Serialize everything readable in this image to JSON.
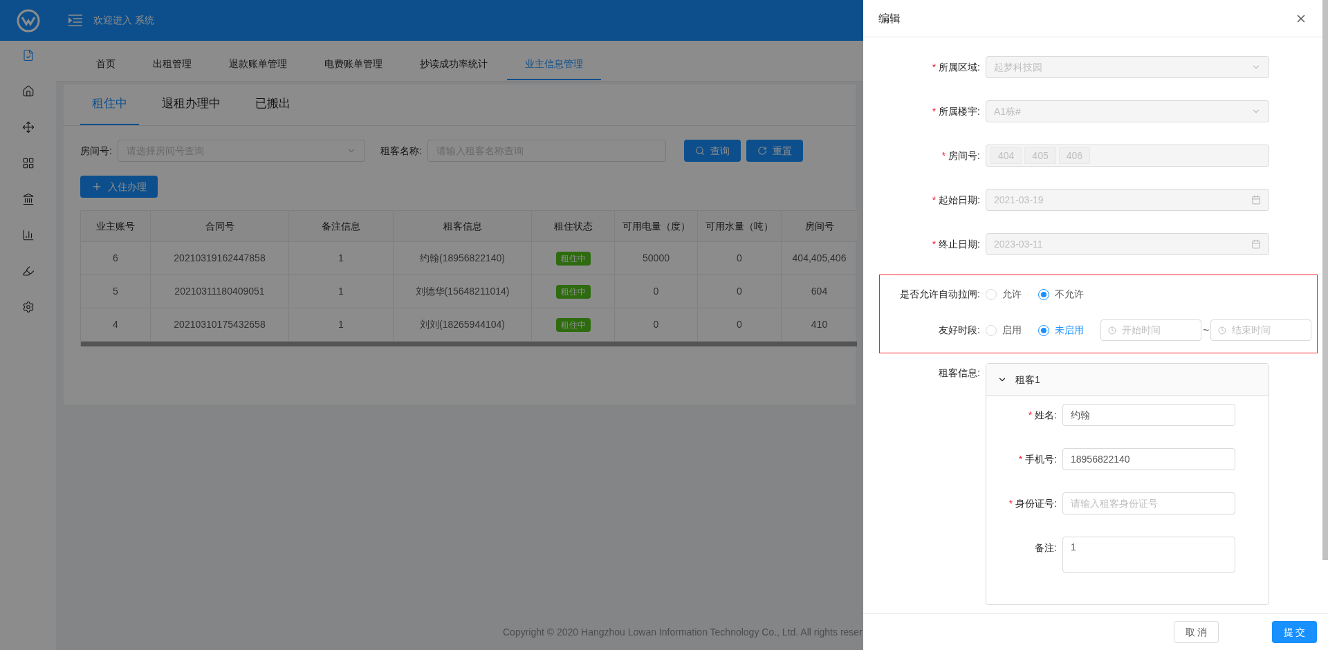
{
  "header": {
    "title": "欢迎进入 系统"
  },
  "sidebar": {
    "items": [
      {
        "kind": "doc",
        "selected": true
      },
      {
        "kind": "home",
        "selected": false
      },
      {
        "kind": "move",
        "selected": false
      },
      {
        "kind": "grid",
        "selected": false
      },
      {
        "kind": "bank",
        "selected": false
      },
      {
        "kind": "chart",
        "selected": false
      },
      {
        "kind": "highlighter",
        "selected": false
      },
      {
        "kind": "settings",
        "selected": false
      }
    ]
  },
  "nav_tabs": [
    {
      "label": "首页",
      "selected": false
    },
    {
      "label": "出租管理",
      "selected": false
    },
    {
      "label": "退款账单管理",
      "selected": false
    },
    {
      "label": "电费账单管理",
      "selected": false
    },
    {
      "label": "抄读成功率统计",
      "selected": false
    },
    {
      "label": "业主信息管理",
      "selected": true
    }
  ],
  "status_tabs": [
    {
      "label": "租住中",
      "selected": true
    },
    {
      "label": "退租办理中",
      "selected": false
    },
    {
      "label": "已搬出",
      "selected": false
    }
  ],
  "filters": [
    {
      "label": "房间号:",
      "placeholder": "请选择房间号查询",
      "kind": "select"
    },
    {
      "label": "租客名称:",
      "placeholder": "请输入租客名称查询",
      "kind": "input"
    }
  ],
  "search_button": "查询",
  "reset_button": "重置",
  "add_button": "入住办理",
  "table": {
    "columns": [
      {
        "label": "业主账号",
        "kind": "text"
      },
      {
        "label": "合同号",
        "kind": "text"
      },
      {
        "label": "备注信息",
        "kind": "text"
      },
      {
        "label": "租客信息",
        "kind": "text"
      },
      {
        "label": "租住状态",
        "kind": "tag"
      },
      {
        "label": "可用电量（度）",
        "kind": "text"
      },
      {
        "label": "可用水量（吨）",
        "kind": "text"
      },
      {
        "label": "房间号",
        "kind": "text"
      }
    ],
    "rows": [
      {
        "cells": [
          "6",
          "20210319162447858",
          "1",
          "约翰(18956822140)",
          "租住中",
          "50000",
          "0",
          "404,405,406"
        ]
      },
      {
        "cells": [
          "5",
          "20210311180409051",
          "1",
          "刘德华(15648211014)",
          "租住中",
          "0",
          "0",
          "604"
        ]
      },
      {
        "cells": [
          "4",
          "20210310175432658",
          "1",
          "刘刘(18265944104)",
          "租住中",
          "0",
          "0",
          "410"
        ]
      }
    ]
  },
  "footer": {
    "copyright": "Copyright © 2020 Hangzhou Lowan Information Technology Co., Ltd. All rights reser"
  },
  "drawer": {
    "title": "编辑",
    "fields": [
      {
        "label": "所属区域:",
        "required_mark": "*",
        "kind": "select",
        "disabled": true,
        "value": "起梦科技园"
      },
      {
        "label": "所属楼宇:",
        "required_mark": "*",
        "kind": "select",
        "disabled": true,
        "value": "A1栋#"
      },
      {
        "label": "房间号:",
        "required_mark": "*",
        "kind": "tags",
        "disabled": true,
        "tags": [
          "404",
          "405",
          "406"
        ]
      },
      {
        "label": "起始日期:",
        "required_mark": "*",
        "kind": "date",
        "disabled": true,
        "value": "2021-03-19"
      },
      {
        "label": "终止日期:",
        "required_mark": "*",
        "kind": "date",
        "disabled": true,
        "value": "2023-03-11"
      }
    ],
    "auto_gate": {
      "label": "是否允许自动拉闸:",
      "options": [
        {
          "label": "允许",
          "selected": false
        },
        {
          "label": "不允许",
          "selected": true
        }
      ]
    },
    "friendly_period": {
      "label": "友好时段:",
      "options": [
        {
          "label": "启用",
          "selected": false
        },
        {
          "label": "未启用",
          "selected": true
        }
      ],
      "start_placeholder": "开始时间",
      "separator": "~",
      "end_placeholder": "结束时间"
    },
    "tenants": {
      "label": "租客信息:",
      "panels": [
        {
          "title": "租客1",
          "expanded": true,
          "fields": [
            {
              "label": "姓名:",
              "required_mark": "*",
              "kind": "input",
              "value": "约翰"
            },
            {
              "label": "手机号:",
              "required_mark": "*",
              "kind": "input",
              "value": "18956822140"
            },
            {
              "label": "身份证号:",
              "required_mark": "*",
              "kind": "input",
              "placeholder": "请输入租客身份证号"
            },
            {
              "label": "备注:",
              "kind": "textarea",
              "value": "1"
            }
          ]
        }
      ]
    },
    "cancel_button": "取 消",
    "submit_button": "提 交"
  }
}
